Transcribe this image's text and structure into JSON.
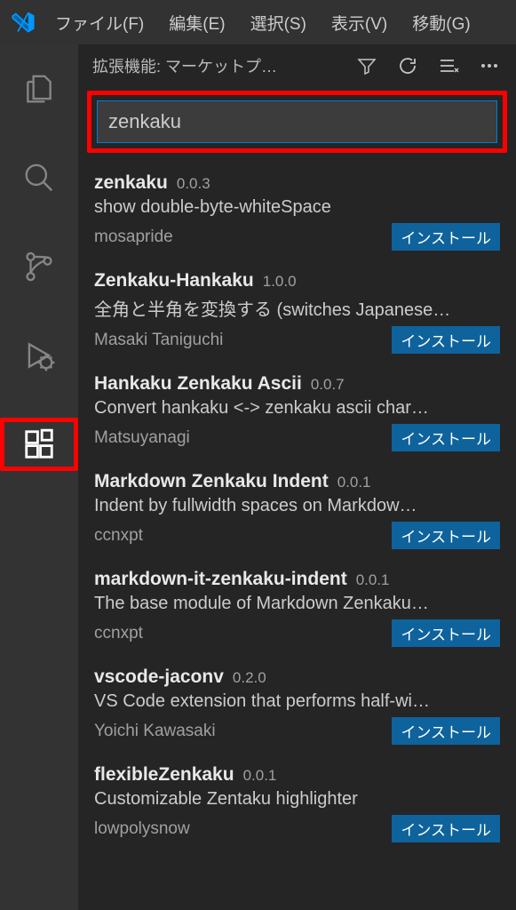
{
  "menubar": {
    "file": "ファイル(F)",
    "edit": "編集(E)",
    "select": "選択(S)",
    "view": "表示(V)",
    "go": "移動(G)"
  },
  "sidebar": {
    "title": "拡張機能: マーケットプ…",
    "search_value": "zenkaku"
  },
  "install_label": "インストール",
  "extensions": [
    {
      "name": "zenkaku",
      "version": "0.0.3",
      "desc": "show double-byte-whiteSpace",
      "author": "mosapride"
    },
    {
      "name": "Zenkaku-Hankaku",
      "version": "1.0.0",
      "desc": "全角と半角を変換する (switches Japanese…",
      "author": "Masaki Taniguchi"
    },
    {
      "name": "Hankaku Zenkaku Ascii",
      "version": "0.0.7",
      "desc": "Convert hankaku <-> zenkaku ascii char…",
      "author": "Matsuyanagi"
    },
    {
      "name": "Markdown Zenkaku Indent",
      "version": "0.0.1",
      "desc": "Indent by fullwidth spaces on Markdow…",
      "author": "ccnxpt"
    },
    {
      "name": "markdown-it-zenkaku-indent",
      "version": "0.0.1",
      "desc": "The base module of Markdown Zenkaku…",
      "author": "ccnxpt"
    },
    {
      "name": "vscode-jaconv",
      "version": "0.2.0",
      "desc": "VS Code extension that performs half-wi…",
      "author": "Yoichi Kawasaki"
    },
    {
      "name": "flexibleZenkaku",
      "version": "0.0.1",
      "desc": "Customizable Zentaku highlighter",
      "author": "lowpolysnow"
    }
  ]
}
